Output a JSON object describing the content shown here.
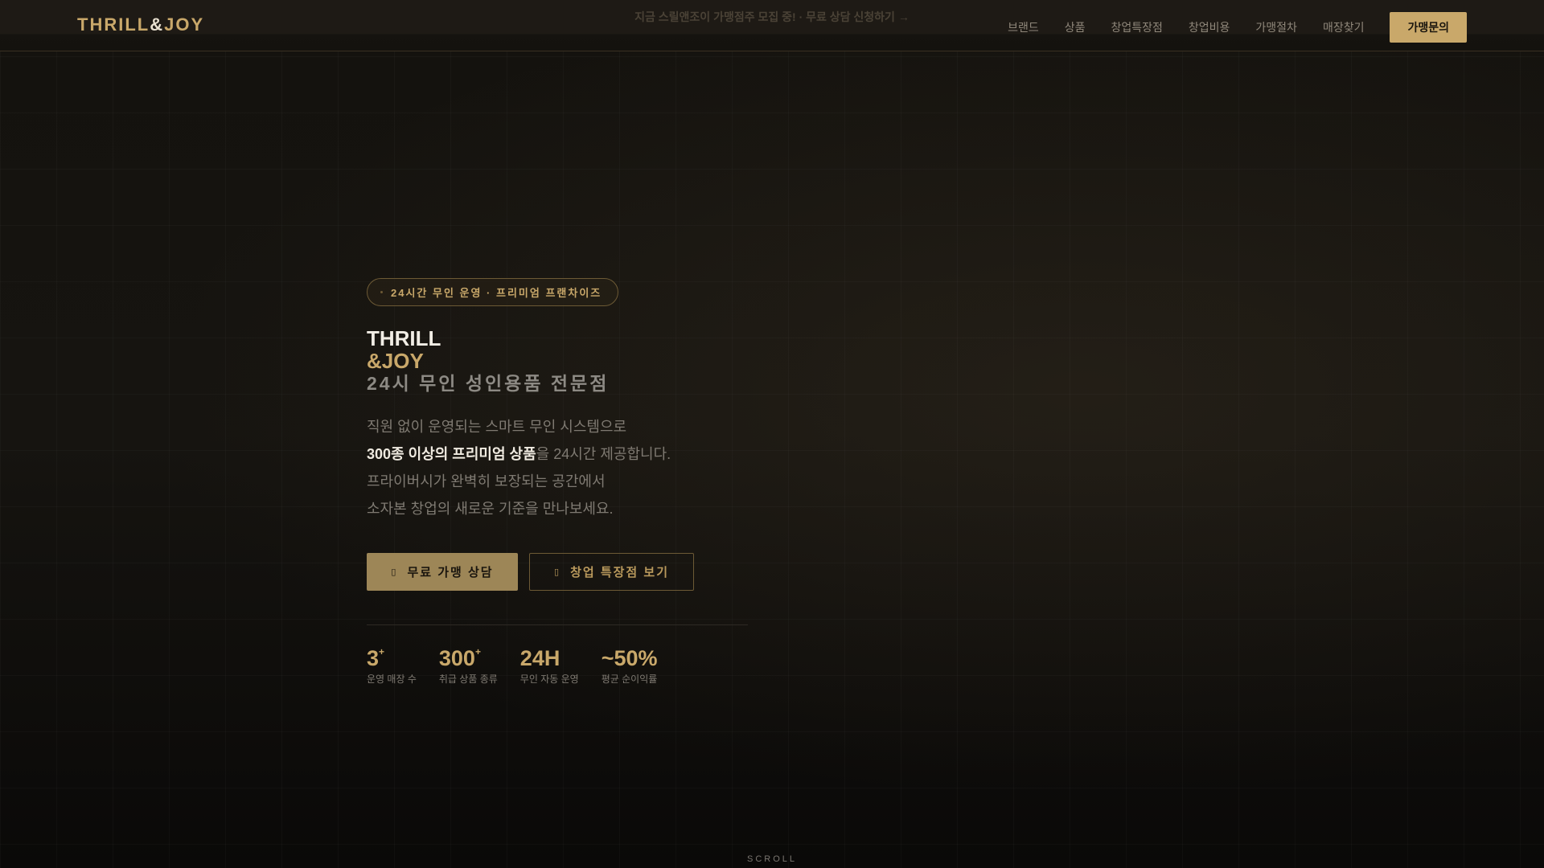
{
  "topbar": {
    "text": "지금 스릴앤조이 가맹점주 모집 중! · 무료 상담 신청하기 →"
  },
  "nav": {
    "logo_main": "THRILL",
    "logo_amp": "&",
    "logo_end": "JOY",
    "links": [
      "브랜드",
      "상품",
      "창업특장점",
      "창업비용",
      "가맹절차",
      "매장찾기"
    ],
    "cta": "가맹문의"
  },
  "hero": {
    "badge": "24시간 무인 운영 · 프리미엄 프랜차이즈",
    "title_1": "THRILL",
    "title_2": "&JOY",
    "title_3": "24시 무인 성인용품 전문점",
    "desc_1": "직원 없이 운영되는 스마트 무인 시스템으로",
    "desc_2_bold": "300종 이상의 프리미엄 상품",
    "desc_2_rest": "을 24시간 제공합니다.",
    "desc_3": "프라이버시가 완벽히 보장되는 공간에서",
    "desc_4": "소자본 창업의 새로운 기준을 만나보세요.",
    "primary_button": "무료 가맹 상담",
    "secondary_button": "창업 특장점 보기",
    "stats": [
      {
        "value": "3",
        "suffix": "+",
        "label": "운영 매장 수"
      },
      {
        "value": "300",
        "suffix": "+",
        "label": "취급 상품 종류"
      },
      {
        "value": "24H",
        "suffix": "",
        "label": "무인 자동 운영"
      },
      {
        "value": "~50%",
        "suffix": "",
        "label": "평균 순이익률"
      }
    ]
  },
  "scroll": "SCROLL"
}
